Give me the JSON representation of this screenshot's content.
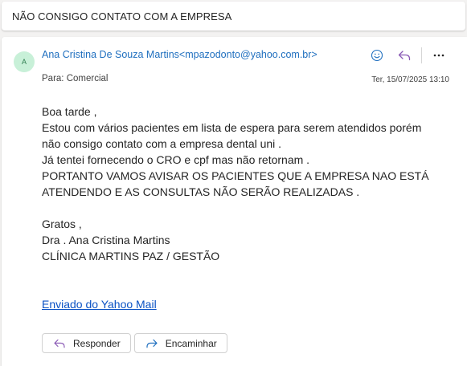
{
  "subject": "NÃO CONSIGO CONTATO COM A EMPRESA",
  "message": {
    "avatar_initial": "A",
    "sender": "Ana Cristina De Souza Martins<mpazodonto@yahoo.com.br>",
    "to_label": "Para:",
    "to_value": "Comercial",
    "date": "Ter, 15/07/2025 13:10",
    "actions": {
      "emoji_icon": "emoji-smile-icon",
      "reply_icon": "reply-arrow-icon",
      "more_icon": "more-options-icon"
    },
    "body": {
      "greeting": "Boa tarde ,",
      "line1": "Estou com vários pacientes em lista de espera para serem atendidos porém",
      "line2": "não consigo contato com a empresa dental uni .",
      "line3": "Já tentei fornecendo o CRO e cpf mas não retornam .",
      "line4": "PORTANTO VAMOS AVISAR OS PACIENTES QUE A EMPRESA NAO ESTÁ",
      "line5": "ATENDENDO E AS CONSULTAS NÃO SERÃO REALIZADAS .",
      "thanks": "Gratos ,",
      "signature_name": "Dra . Ana Cristina Martins",
      "signature_clinic": "CLÍNICA MARTINS PAZ / GESTÃO",
      "yahoo_link": "Enviado do Yahoo Mail "
    },
    "buttons": {
      "reply": "Responder",
      "forward": "Encaminhar"
    }
  },
  "colors": {
    "accent": "#1f6fbf",
    "reply_icon": "#8a5ab5",
    "forward_icon": "#1f6fbf",
    "avatar_bg": "#c8f0d8"
  }
}
